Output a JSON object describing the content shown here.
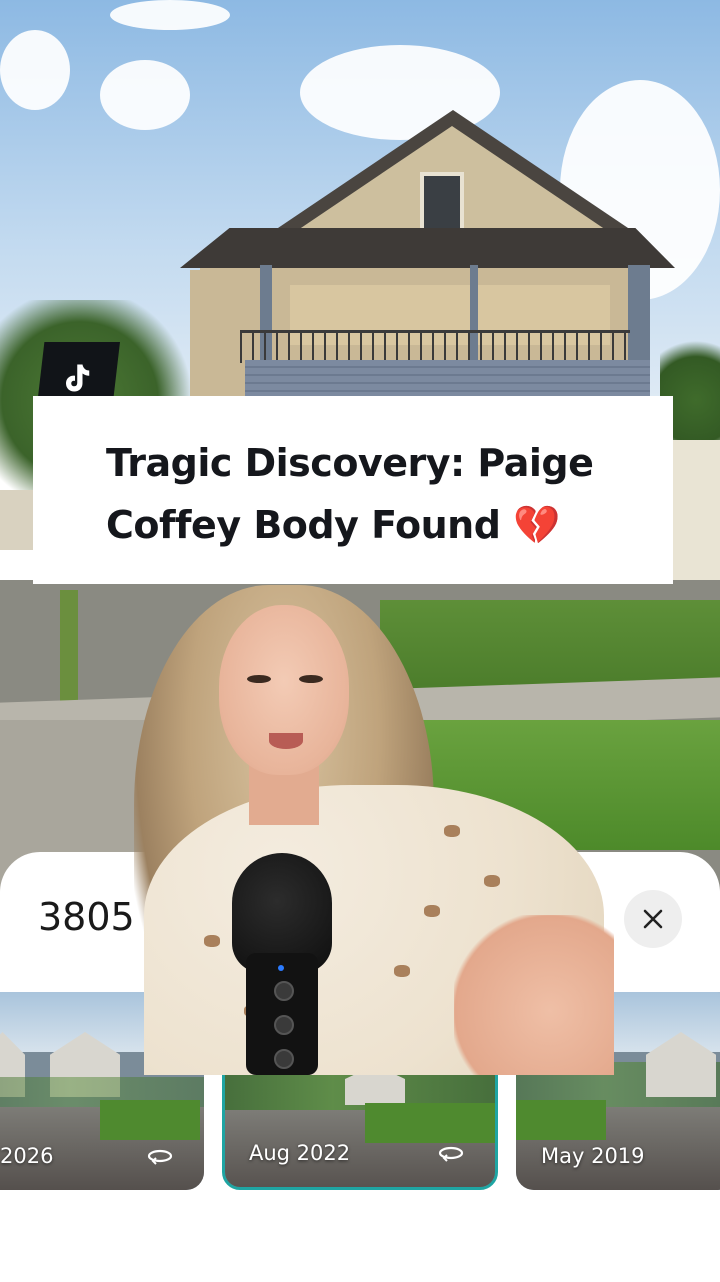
{
  "title_card": {
    "line1": "Tragic Discovery: Paige",
    "line2": "Coffey Body Found 💔"
  },
  "bottom_sheet": {
    "address_fragment": "3805",
    "share_icon": "share-icon",
    "close_icon": "close-icon",
    "thumbnails": [
      {
        "label": "2026",
        "icon": "rotate-360-icon",
        "selected": false
      },
      {
        "label": "Aug 2022",
        "icon": "rotate-360-icon",
        "selected": true
      },
      {
        "label": "May 2019",
        "icon": "",
        "selected": false
      }
    ]
  },
  "badge": {
    "icon": "tiktok-logo-icon"
  },
  "colors": {
    "selected_border": "#1fa5a3",
    "title_text": "#15171c",
    "badge_bg": "#111418"
  }
}
